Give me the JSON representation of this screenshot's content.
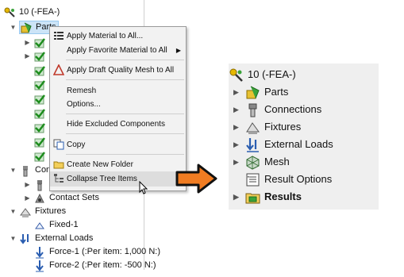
{
  "left_tree": {
    "root_label": "10 (-FEA-)",
    "parts_label": "Parts",
    "connections_label": "Conne",
    "contact_sets_label": "Contact Sets",
    "fixtures_label": "Fixtures",
    "fixed_label": "Fixed-1",
    "external_loads_label": "External Loads",
    "force1_label": "Force-1 (:Per item: 1,000 N:)",
    "force2_label": "Force-2 (:Per item: -500 N:)"
  },
  "context_menu": {
    "items": [
      {
        "label": "Apply Material to All...",
        "icon": "material-list-icon"
      },
      {
        "label": "Apply Favorite Material to All",
        "icon": "",
        "submenu": true
      },
      {
        "label": "Apply Draft Quality Mesh to All",
        "icon": "warning-triangle-icon"
      },
      {
        "label": "Remesh",
        "icon": ""
      },
      {
        "label": "Options...",
        "icon": ""
      },
      {
        "label": "Hide Excluded Components",
        "icon": ""
      },
      {
        "label": "Copy",
        "icon": "copy-icon"
      },
      {
        "label": "Create New Folder",
        "icon": "folder-icon"
      },
      {
        "label": "Collapse Tree Items",
        "icon": "collapse-tree-icon"
      }
    ]
  },
  "right_tree": {
    "root_label": "10 (-FEA-)",
    "items": [
      {
        "label": "Parts",
        "icon": "parts-icon"
      },
      {
        "label": "Connections",
        "icon": "connections-icon"
      },
      {
        "label": "Fixtures",
        "icon": "fixtures-icon"
      },
      {
        "label": "External Loads",
        "icon": "external-loads-icon"
      },
      {
        "label": "Mesh",
        "icon": "mesh-icon"
      },
      {
        "label": "Result Options",
        "icon": "result-options-icon"
      },
      {
        "label": "Results",
        "icon": "results-icon"
      }
    ]
  },
  "colors": {
    "accent_orange": "#f07c22",
    "part_green": "#3aa33a",
    "load_blue": "#2a5db0",
    "menu_background": "#f2f2f2",
    "panel_background": "#efefef"
  }
}
